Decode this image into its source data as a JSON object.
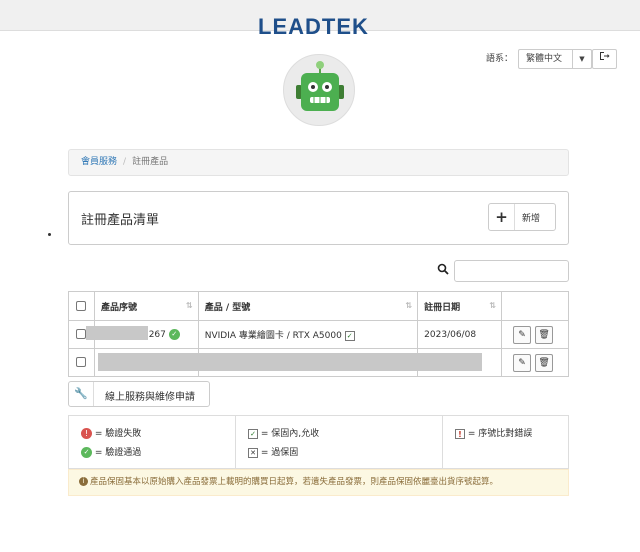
{
  "brand": {
    "logo_text": "LEADTEK",
    "accent": "#1f4f8a"
  },
  "header": {
    "language_label": "語系：",
    "language_value": "繁體中文",
    "logout_icon": "sign-out-icon"
  },
  "breadcrumb": {
    "items": [
      "會員服務",
      "註冊產品"
    ]
  },
  "panel": {
    "title": "註冊產品清單",
    "add_label": "新增"
  },
  "search": {
    "placeholder": "",
    "value": ""
  },
  "table": {
    "headers": [
      "產品序號",
      "產品 / 型號",
      "註冊日期"
    ],
    "rows": [
      {
        "serial": "5267",
        "product": "NVIDIA 專業繪圖卡 / RTX A5000",
        "date": "2023/06/08"
      },
      {
        "serial": "",
        "product": "",
        "date": ""
      }
    ]
  },
  "service_button": {
    "label": "線上服務與維修申請"
  },
  "legend": {
    "col1": [
      "= 驗證失敗",
      "= 驗證通過"
    ],
    "col2": [
      "= 保固內,允收",
      "= 過保固"
    ],
    "col3": [
      "= 序號比對錯誤"
    ]
  },
  "notice": "產品保固基本以原始購入產品發票上載明的購買日起算，若遺失產品發票，則產品保固依麗臺出貨序號起算。",
  "colors": {
    "success": "#5cb85c",
    "danger": "#d9534f",
    "warning_bg": "#fcf8e3",
    "link": "#337ab7"
  }
}
